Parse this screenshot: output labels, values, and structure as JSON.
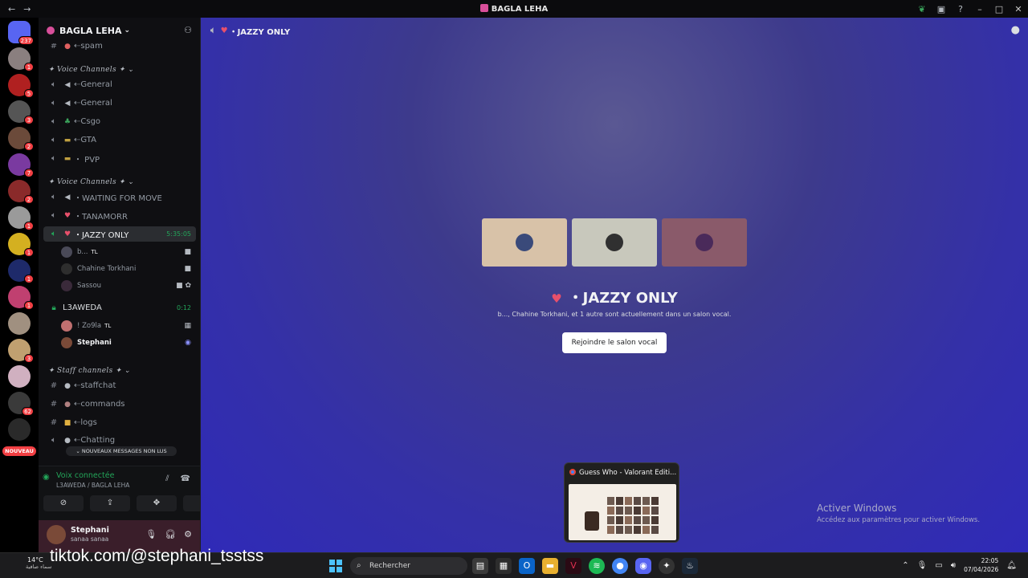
{
  "titlebar": {
    "title": "BAGLA LEHA"
  },
  "rail": {
    "servers": [
      {
        "badge": "237",
        "color": "#5865f2"
      },
      {
        "badge": "1",
        "color": "#8a7f7f"
      },
      {
        "badge": "5",
        "color": "#b02020"
      },
      {
        "badge": "3",
        "color": "#555555"
      },
      {
        "badge": "2",
        "color": "#6b4a3a"
      },
      {
        "badge": "7",
        "color": "#7a3aa0"
      },
      {
        "badge": "2",
        "color": "#8a2a2a"
      },
      {
        "badge": "1",
        "color": "#9a9a9a"
      },
      {
        "badge": "1",
        "color": "#d4b020"
      },
      {
        "badge": "1",
        "color": "#1e2a6a"
      },
      {
        "badge": "1",
        "color": "#c04070"
      },
      {
        "badge": "",
        "color": "#a09080"
      },
      {
        "badge": "3",
        "color": "#c0a070"
      },
      {
        "badge": "",
        "color": "#d0b0c0"
      },
      {
        "badge": "62",
        "color": "#3a3a3a"
      },
      {
        "badge": "",
        "color": "#2a2a2a"
      }
    ],
    "new_label": "NOUVEAU"
  },
  "guild": {
    "name": "BAGLA LEHA"
  },
  "channels": {
    "top_channel": {
      "emoji": "●",
      "name": "⇠spam"
    },
    "cat1": "✦ Voice Channels ✦",
    "voice1": [
      {
        "emoji": "◀",
        "name": "⇠General"
      },
      {
        "emoji": "◀",
        "name": "⇠General"
      },
      {
        "emoji": "♣",
        "name": "⇠Csgo"
      },
      {
        "emoji": "▬",
        "name": "⇠GTA"
      },
      {
        "emoji": "▬",
        "name": "・ PVP"
      }
    ],
    "cat2": "✦ Voice Channels ✦",
    "voice2": [
      {
        "emoji": "◀",
        "name": "・WAITING FOR MOVE"
      },
      {
        "emoji": "♥",
        "name": "・TANAMORR"
      }
    ],
    "active": {
      "emoji": "♥",
      "name": "・JAZZY ONLY",
      "duration": "5:35:05"
    },
    "active_users": [
      {
        "name": "b...",
        "tag": "TL"
      },
      {
        "name": "Chahine Torkhani",
        "tag": ""
      },
      {
        "name": "Sassou",
        "tag": ""
      }
    ],
    "locked": {
      "name": "L3AWEDA",
      "duration": "0:12"
    },
    "locked_users": [
      {
        "name": "! Zo9la",
        "tag": "TL"
      },
      {
        "name": "Stephani",
        "tag": ""
      }
    ],
    "cat3": "✦ Staff channels ✦",
    "staff": [
      {
        "emoji": "●",
        "name": "⇠staffchat"
      },
      {
        "emoji": "●",
        "name": "⇠commands"
      },
      {
        "emoji": "■",
        "name": "⇠logs"
      },
      {
        "emoji": "●",
        "name": "⇠Chatting"
      }
    ],
    "unread_pill": "NOUVEAUX MESSAGES NON LUS"
  },
  "voice_panel": {
    "status": "Voix connectée",
    "location": "L3AWEDA / BAGLA LEHA"
  },
  "user_panel": {
    "name": "Stephani",
    "status": "sanaa sanaa"
  },
  "main": {
    "header_channel": "・JAZZY ONLY",
    "title": "・JAZZY ONLY",
    "description": "b..., Chahine Torkhani, et 1 autre sont actuellement dans un salon vocal.",
    "join_label": "Rejoindre le salon vocal",
    "tiles": [
      {
        "bg": "#d8c2a8",
        "av": "#3a4a7a"
      },
      {
        "bg": "#c8c8bc",
        "av": "#303030"
      },
      {
        "bg": "#8a5a6a",
        "av": "#4a2a5a"
      }
    ]
  },
  "activation": {
    "line1": "Activer Windows",
    "line2": "Accédez aux paramètres pour activer Windows."
  },
  "thumbnail": {
    "title": "Guess Who - Valorant Editi..."
  },
  "taskbar": {
    "temp": "14°C",
    "weather_text": "سماء صافية",
    "overlay_text": "tiktok.com/@stephani_tsstss",
    "search_placeholder": "Rechercher",
    "time": "22:05",
    "date": "07/04/2026"
  }
}
